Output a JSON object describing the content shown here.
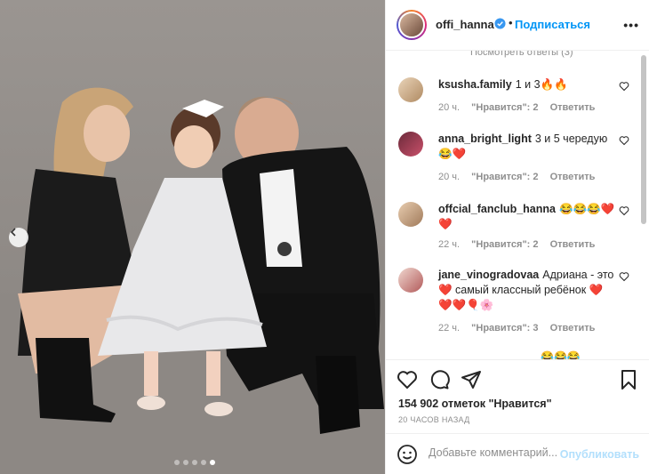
{
  "header": {
    "username": "offi_hanna",
    "follow_label": "Подписаться",
    "separator": "•",
    "more_label": "•••"
  },
  "comments": {
    "faded_text": "Посмотреть ответы (3)",
    "items": [
      {
        "username": "ksusha.family",
        "text": "1 и 3🔥🔥",
        "time": "20 ч.",
        "likes": "\"Нравится\": 2",
        "reply": "Ответить"
      },
      {
        "username": "anna_bright_light",
        "text": "3 и 5 чередую 😂❤️",
        "time": "20 ч.",
        "likes": "\"Нравится\": 2",
        "reply": "Ответить"
      },
      {
        "username": "offcial_fanclub_hanna",
        "text": "😂😂😂❤️❤️",
        "time": "22 ч.",
        "likes": "\"Нравится\": 2",
        "reply": "Ответить"
      },
      {
        "username": "jane_vinogradovaa",
        "text": "Адриана - это ❤️ самый классный ребёнок ❤️❤️❤️🎈🌸",
        "time": "22 ч.",
        "likes": "\"Нравится\": 3",
        "reply": "Ответить"
      }
    ],
    "partial_text": "😂😂😂"
  },
  "post": {
    "likes_text": "154 902 отметок \"Нравится\"",
    "time_ago": "20 ЧАСОВ НАЗАД"
  },
  "composer": {
    "placeholder": "Добавьте комментарий...",
    "publish_label": "Опубликовать"
  },
  "carousel": {
    "slides": 5,
    "active_index": 4
  },
  "colors": {
    "link": "#0095f6",
    "muted": "#8e8e8e",
    "publish_disabled": "#b2dffc",
    "heart": "#ed4956"
  }
}
